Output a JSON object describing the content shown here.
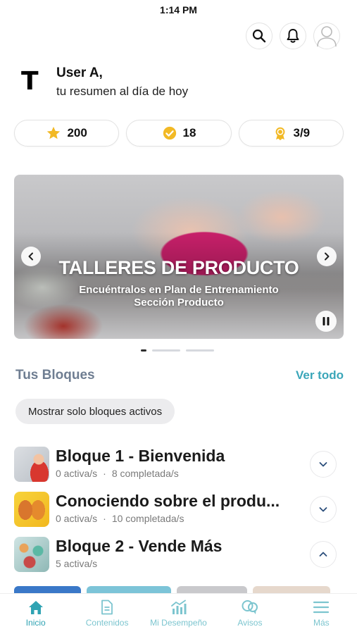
{
  "status_bar": {
    "time": "1:14 PM"
  },
  "header": {
    "actions": [
      {
        "icon": "search-icon"
      },
      {
        "icon": "bell-icon"
      },
      {
        "icon": "user-avatar-icon"
      }
    ]
  },
  "greeting": {
    "logo": "T",
    "name": "User A,",
    "subtitle": "tu resumen al día de hoy"
  },
  "stats": [
    {
      "icon": "star-icon",
      "value": "200",
      "color": "#f2b925"
    },
    {
      "icon": "check-badge-icon",
      "value": "18",
      "color": "#f2b925"
    },
    {
      "icon": "medal-icon",
      "value": "3/9",
      "color": "#f2b925"
    }
  ],
  "banner": {
    "title": "TALLERES DE PRODUCTO",
    "subtitle_line1": "Encuéntralos en Plan de Entrenamiento",
    "subtitle_line2": "Sección Producto",
    "slides_total": 3,
    "active_slide": 1
  },
  "blocks_section": {
    "title": "Tus Bloques",
    "see_all": "Ver todo",
    "filter_chip": "Mostrar solo bloques activos",
    "items": [
      {
        "title": "Bloque 1 - Bienvenida",
        "active": "0 activa/s",
        "completed": "8 completada/s",
        "expanded": false
      },
      {
        "title": "Conociendo sobre el produ...",
        "active": "0 activa/s",
        "completed": "10 completada/s",
        "expanded": false
      },
      {
        "title": "Bloque 2 - Vende Más",
        "active": "5 activa/s",
        "completed": "",
        "expanded": true
      }
    ]
  },
  "tabbar": {
    "items": [
      {
        "label": "Inicio",
        "icon": "home-icon",
        "active": true
      },
      {
        "label": "Contenidos",
        "icon": "document-icon",
        "active": false
      },
      {
        "label": "Mi Desempeño",
        "icon": "performance-chart-icon",
        "active": false
      },
      {
        "label": "Avisos",
        "icon": "chat-bubbles-icon",
        "active": false
      },
      {
        "label": "Más",
        "icon": "menu-icon",
        "active": false
      }
    ],
    "accent_color": "#2fa3b3"
  }
}
